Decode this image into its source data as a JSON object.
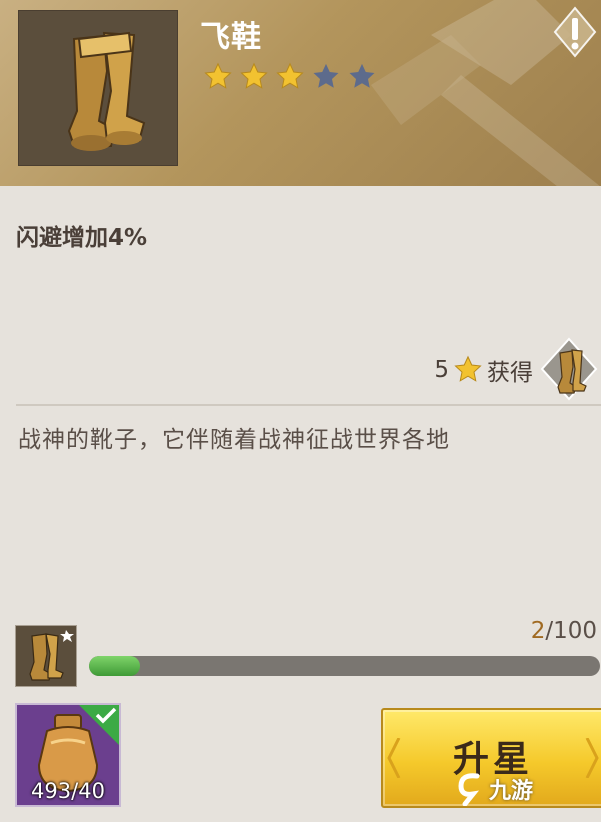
{
  "item": {
    "name": "飞鞋",
    "rating": 3,
    "max_rating": 5
  },
  "effect_text": "闪避增加4%",
  "obtain": {
    "star_requirement": "5",
    "label": "获得"
  },
  "description": "战神的靴子，它伴随着战神征战世界各地",
  "progress": {
    "current": "2",
    "total": "/100",
    "fraction": 0.02
  },
  "material": {
    "count": "493/40"
  },
  "upgrade_button": {
    "label": "升星"
  },
  "watermark": {
    "brand": "九游"
  },
  "colors": {
    "header": "#b3955c",
    "star_filled": "#f2c230",
    "star_empty": "#5d6b8c",
    "progress_fill": "#5cb84a",
    "button": "#f5c92b",
    "item_bg": "#6b3f8e"
  }
}
